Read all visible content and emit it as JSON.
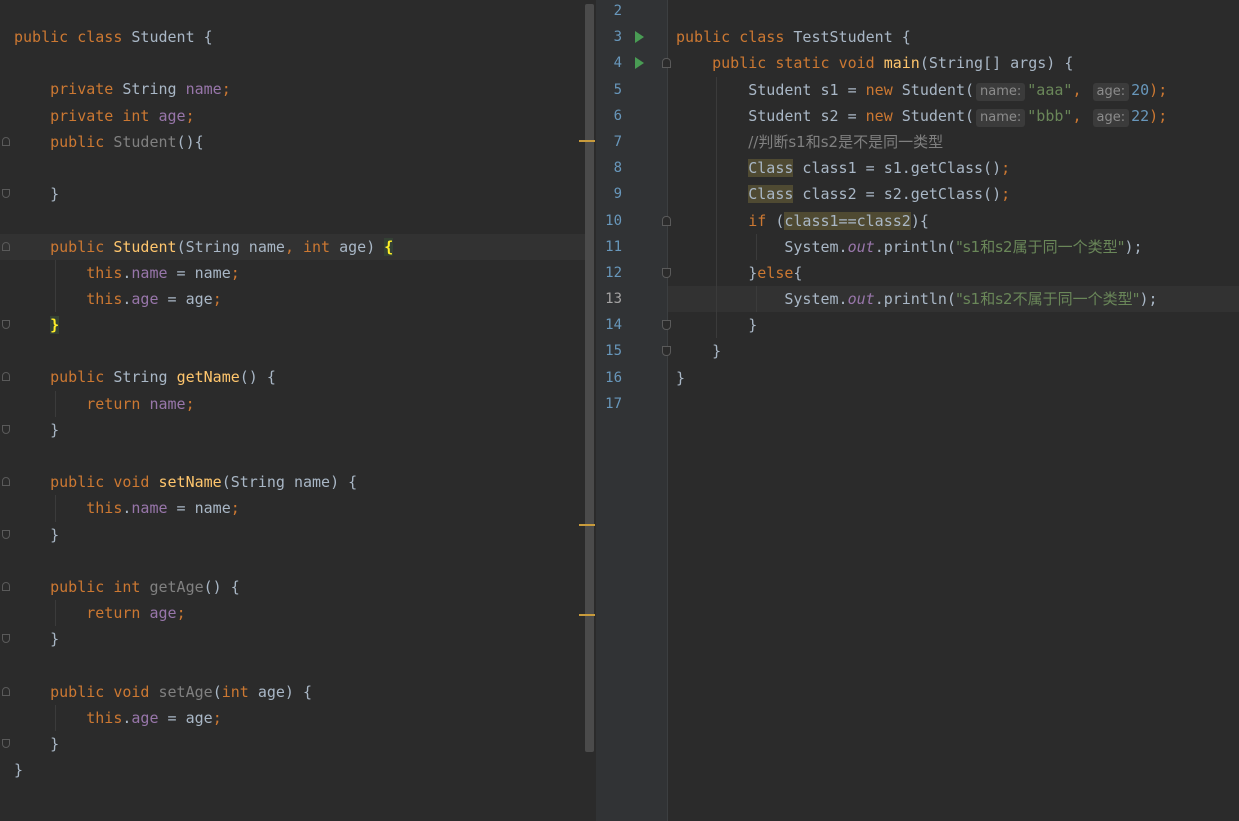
{
  "left_editor": {
    "lines": [
      [
        "public",
        " ",
        "class",
        " Student {"
      ],
      [
        ""
      ],
      [
        "    ",
        "private",
        " String ",
        "name",
        ";"
      ],
      [
        "    ",
        "private",
        " ",
        "int",
        " ",
        "age",
        ";"
      ],
      [
        "    ",
        "public",
        " ",
        "Student",
        "(){"
      ],
      [
        ""
      ],
      [
        "    }"
      ],
      [
        ""
      ],
      [
        "    ",
        "public",
        " ",
        "Student",
        "(String name",
        ", ",
        "int",
        " age) ",
        "{"
      ],
      [
        "        ",
        "this",
        ".",
        "name",
        " = name",
        ";"
      ],
      [
        "        ",
        "this",
        ".",
        "age",
        " = age",
        ";"
      ],
      [
        "    ",
        "}"
      ],
      [
        ""
      ],
      [
        "    ",
        "public",
        " String ",
        "getName",
        "() {"
      ],
      [
        "        ",
        "return",
        " ",
        "name",
        ";"
      ],
      [
        "    }"
      ],
      [
        ""
      ],
      [
        "    ",
        "public",
        " ",
        "void",
        " ",
        "setName",
        "(String name) {"
      ],
      [
        "        ",
        "this",
        ".",
        "name",
        " = name",
        ";"
      ],
      [
        "    }"
      ],
      [
        ""
      ],
      [
        "    ",
        "public",
        " ",
        "int",
        " ",
        "getAge",
        "() {"
      ],
      [
        "        ",
        "return",
        " ",
        "age",
        ";"
      ],
      [
        "    }"
      ],
      [
        ""
      ],
      [
        "    ",
        "public",
        " ",
        "void",
        " ",
        "setAge",
        "(",
        "int",
        " age) {"
      ],
      [
        "        ",
        "this",
        ".",
        "age",
        " = age",
        ";"
      ],
      [
        "    }"
      ],
      [
        "}"
      ]
    ]
  },
  "right_editor": {
    "line_numbers": [
      "2",
      "3",
      "4",
      "5",
      "6",
      "7",
      "8",
      "9",
      "10",
      "11",
      "12",
      "13",
      "14",
      "15",
      "16",
      "17"
    ],
    "current_line": "13",
    "lines": [
      [
        ""
      ],
      [
        "public",
        " ",
        "class",
        " TestStudent {"
      ],
      [
        "    ",
        "public",
        " ",
        "static",
        " ",
        "void",
        " ",
        "main",
        "(String[] args) {"
      ],
      [
        "        Student s1 = ",
        "new",
        " Student(",
        "name:",
        "\"aaa\"",
        ", ",
        "age:",
        "20",
        ");"
      ],
      [
        "        Student s2 = ",
        "new",
        " Student(",
        "name:",
        "\"bbb\"",
        ", ",
        "age:",
        "22",
        ");"
      ],
      [
        "        ",
        "//判断s1和s2是不是同一类型"
      ],
      [
        "        ",
        "Class",
        " class1 = s1.getClass()",
        ";"
      ],
      [
        "        ",
        "Class",
        " class2 = s2.getClass()",
        ";"
      ],
      [
        "        ",
        "if",
        " (",
        "class1==class2",
        "){"
      ],
      [
        "            System.",
        "out",
        ".println(",
        "\"s1和s2属于同一个类型\"",
        ");"
      ],
      [
        "        }",
        "else",
        "{"
      ],
      [
        "            System.",
        "out",
        ".println(",
        "\"s1和s2不属于同一个类型\"",
        ");"
      ],
      [
        "        }"
      ],
      [
        "    }"
      ],
      [
        "}"
      ],
      [
        ""
      ]
    ]
  },
  "colors": {
    "background": "#2b2b2b",
    "keyword": "#cc7832",
    "field": "#9876aa",
    "method": "#ffc66d",
    "string": "#6a8759",
    "number": "#6897bb",
    "comment": "#808080",
    "run_icon": "#499c54"
  },
  "icons": {
    "run": "run-gutter-icon",
    "fold": "fold-marker-icon"
  }
}
